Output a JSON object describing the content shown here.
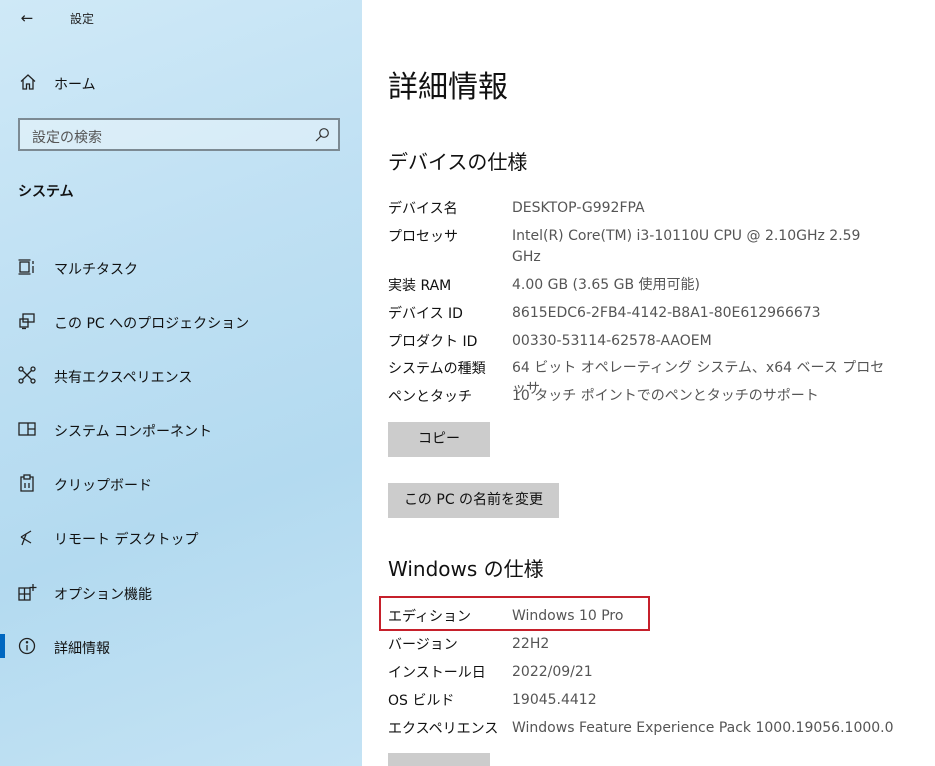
{
  "sidebar": {
    "back_glyph": "←",
    "title": "設定",
    "home": {
      "label": "ホーム",
      "icon": "home-icon"
    },
    "search": {
      "placeholder": "設定の検索",
      "icon": "search-icon"
    },
    "section": "システム",
    "items": [
      {
        "label": "マルチタスク",
        "icon": "multitasking-icon",
        "active": false
      },
      {
        "label": "この PC へのプロジェクション",
        "icon": "projection-icon",
        "active": false
      },
      {
        "label": "共有エクスペリエンス",
        "icon": "shared-experiences-icon",
        "active": false
      },
      {
        "label": "システム コンポーネント",
        "icon": "system-components-icon",
        "active": false
      },
      {
        "label": "クリップボード",
        "icon": "clipboard-icon",
        "active": false
      },
      {
        "label": "リモート デスクトップ",
        "icon": "remote-desktop-icon",
        "active": false
      },
      {
        "label": "オプション機能",
        "icon": "optional-features-icon",
        "active": false
      },
      {
        "label": "詳細情報",
        "icon": "info-icon",
        "active": true
      }
    ],
    "accent_color": "#0067c0"
  },
  "main": {
    "title": "詳細情報",
    "device_specs": {
      "heading": "デバイスの仕様",
      "rows": [
        {
          "key": "デバイス名",
          "value": "DESKTOP-G992FPA"
        },
        {
          "key": "プロセッサ",
          "value": "Intel(R) Core(TM) i3-10110U CPU @ 2.10GHz   2.59 GHz"
        },
        {
          "key": "実装 RAM",
          "value": "4.00 GB (3.65 GB 使用可能)"
        },
        {
          "key": "デバイス ID",
          "value": "8615EDC6-2FB4-4142-B8A1-80E612966673"
        },
        {
          "key": "プロダクト ID",
          "value": "00330-53114-62578-AAOEM"
        },
        {
          "key": "システムの種類",
          "value": "64 ビット オペレーティング システム、x64 ベース プロセッサ"
        },
        {
          "key": "ペンとタッチ",
          "value": "10 タッチ ポイントでのペンとタッチのサポート"
        }
      ],
      "copy_button": "コピー",
      "rename_button": "この PC の名前を変更"
    },
    "windows_specs": {
      "heading": "Windows の仕様",
      "rows": [
        {
          "key": "エディション",
          "value": "Windows 10 Pro"
        },
        {
          "key": "バージョン",
          "value": "22H2"
        },
        {
          "key": "インストール日",
          "value": "2022/09/21"
        },
        {
          "key": "OS ビルド",
          "value": "19045.4412"
        },
        {
          "key": "エクスペリエンス",
          "value": "Windows Feature Experience Pack 1000.19056.1000.0"
        }
      ]
    },
    "highlight_color": "#c6202b"
  }
}
